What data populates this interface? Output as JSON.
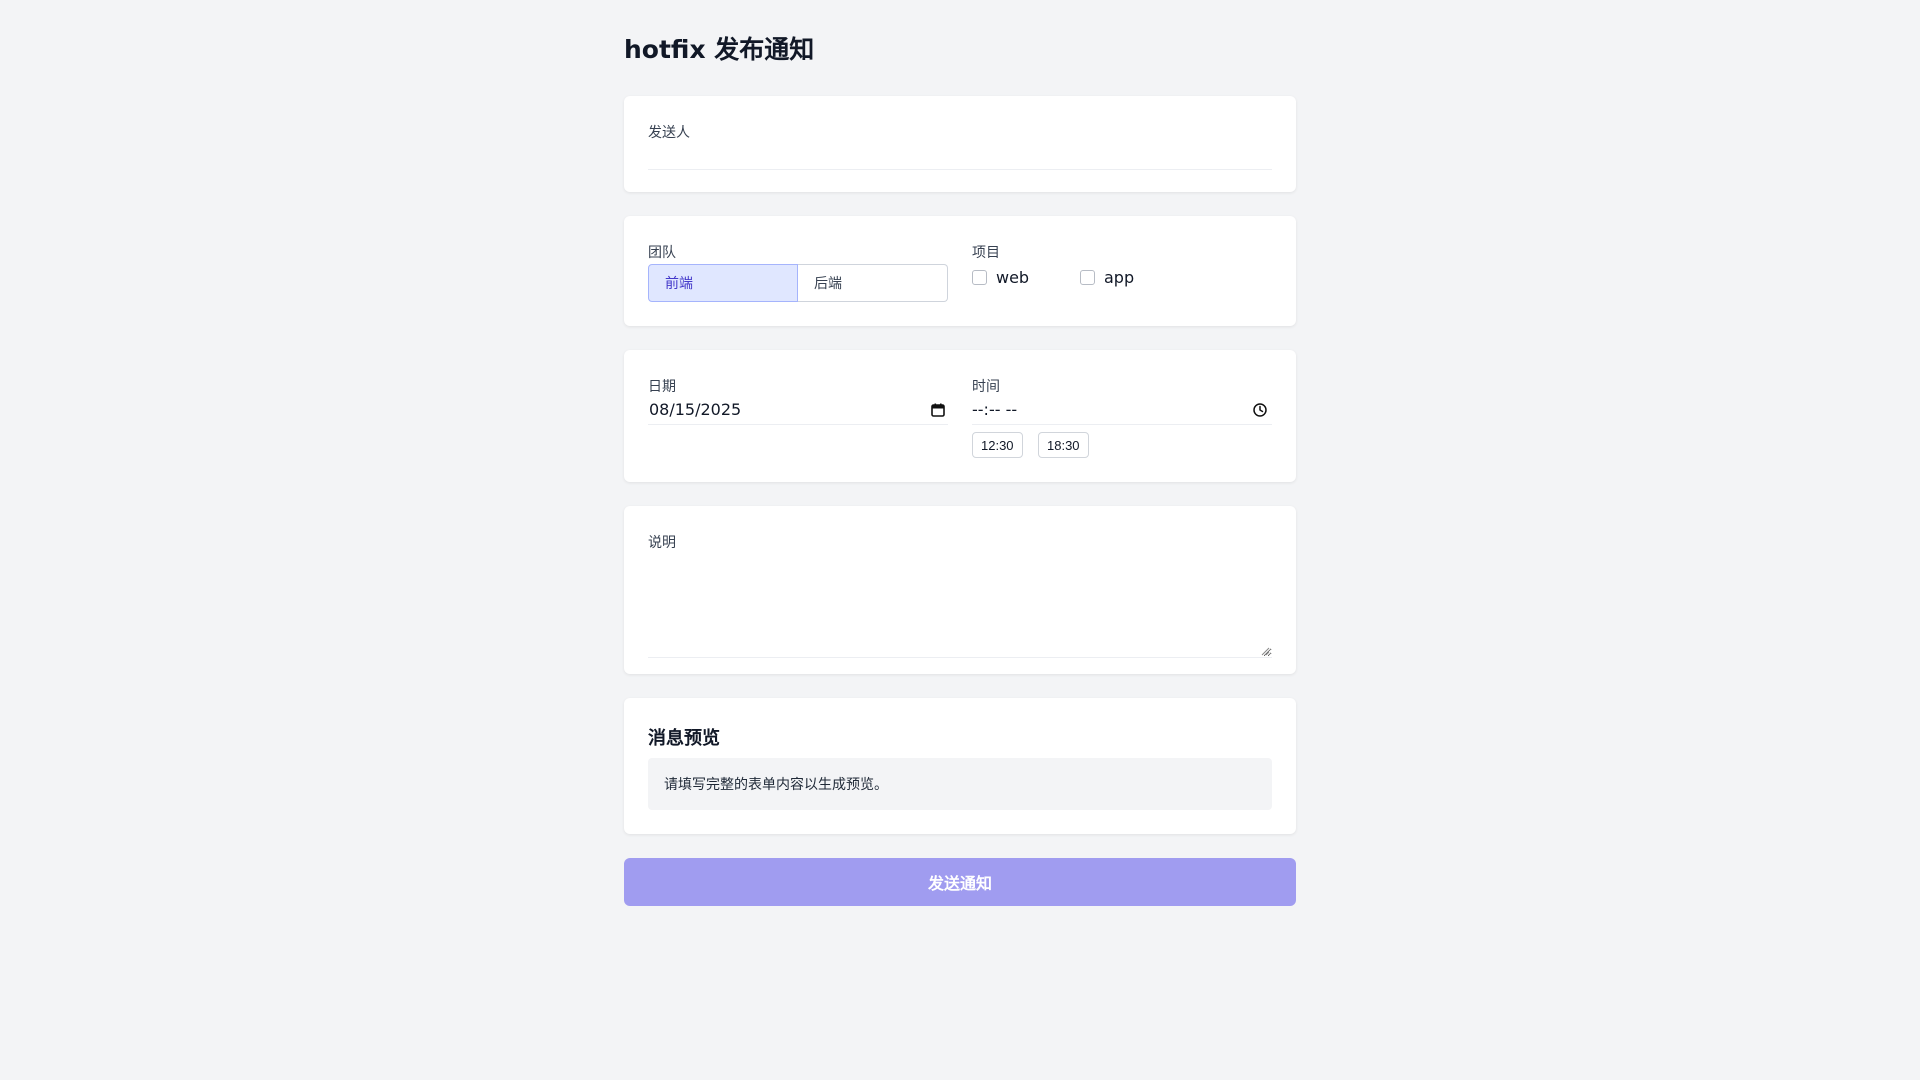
{
  "page": {
    "title": "hotfix 发布通知"
  },
  "sender": {
    "label": "发送人",
    "value": ""
  },
  "team": {
    "label": "团队",
    "options": [
      "前端",
      "后端"
    ],
    "selected": "前端"
  },
  "project": {
    "label": "项目",
    "options": [
      "web",
      "app"
    ],
    "checked": []
  },
  "date": {
    "label": "日期",
    "value": "08/15/2025",
    "icon": "calendar-icon"
  },
  "time": {
    "label": "时间",
    "value": "--:-- --",
    "icon": "clock-icon",
    "presets": [
      "12:30",
      "18:30"
    ]
  },
  "description": {
    "label": "说明",
    "value": ""
  },
  "preview": {
    "title": "消息预览",
    "placeholder": "请填写完整的表单内容以生成预览。"
  },
  "submit": {
    "label": "发送通知",
    "disabled": true
  },
  "colors": {
    "background": "#f3f4f6",
    "card": "#ffffff",
    "accent_light": "#e0e7ff",
    "accent_text": "#4338ca",
    "button_disabled": "#a09cf0"
  }
}
